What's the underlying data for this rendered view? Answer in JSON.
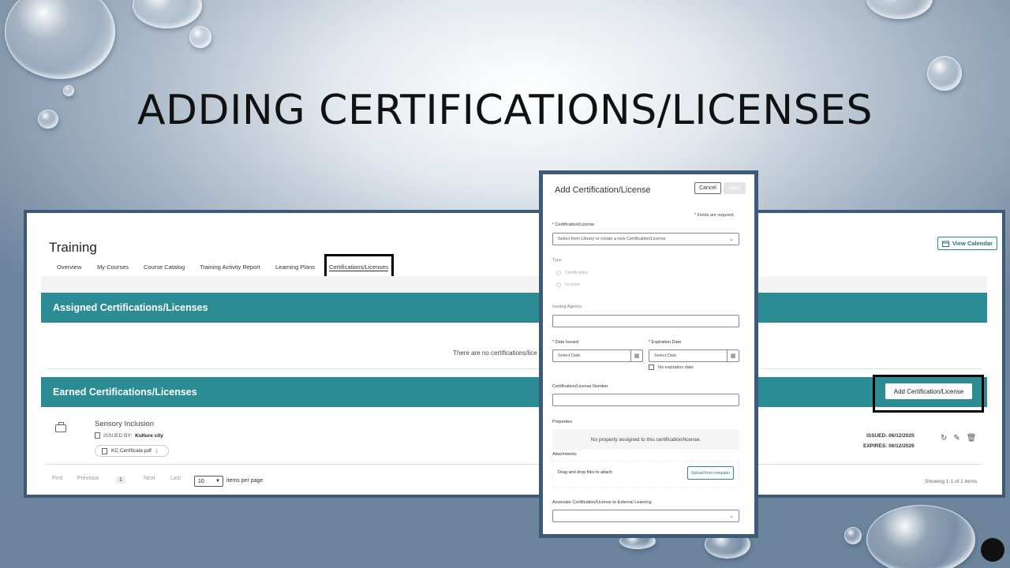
{
  "slide": {
    "title": "ADDING CERTIFICATIONS/LICENSES"
  },
  "training": {
    "title": "Training",
    "tabs": [
      "Overview",
      "My Courses",
      "Course Catalog",
      "Training Activity Report",
      "Learning Plans",
      "Certifications/Licenses"
    ],
    "active_tab": "Certifications/Licenses",
    "view_calendar": "View Calendar",
    "assigned_header": "Assigned Certifications/Licenses",
    "assigned_empty": "There are no certifications/lice",
    "earned_header": "Earned Certifications/Licenses",
    "add_button": "Add Certification/License",
    "earned_item": {
      "name": "Sensory Inclusion",
      "issued_by_label": "ISSUED BY:",
      "issued_by": "Kulture city",
      "file": "KC Certificate.pdf",
      "issued": "ISSUED: 06/12/2025",
      "expires": "EXPIRES: 06/12/2026"
    },
    "pagination": {
      "first": "First",
      "previous": "Previous",
      "current": "1",
      "next": "Next",
      "last": "Last",
      "per_page": "10",
      "per_page_label": "items per page",
      "showing": "Showing 1-1 of 1 items"
    }
  },
  "modal": {
    "title": "Add Certification/License",
    "cancel": "Cancel",
    "save": "Save",
    "required_note": "* Fields are required.",
    "cert_label": "* Certification/License",
    "cert_placeholder": "Select from Library or create a new Certification/License",
    "type_label": "Type",
    "type_options": [
      "Certification",
      "License"
    ],
    "agency_label": "Issuing Agency",
    "date_issued_label": "* Date Issued",
    "expiration_label": "* Expiration Date",
    "date_placeholder": "Select Date",
    "no_expiration": "No expiration date",
    "number_label": "Certification/License Number",
    "properties_label": "Properties",
    "properties_empty": "No property assigned to this certification/license.",
    "attachments_label": "Attachments",
    "drag_drop": "Drag and drop files to attach",
    "upload": "Upload from computer",
    "associate_label": "Associate Certification/License to External Learning"
  },
  "icons": [
    "calendar-icon",
    "briefcase-icon",
    "document-icon",
    "download-icon",
    "reset-icon",
    "edit-icon",
    "trash-icon",
    "chevron-down-icon"
  ]
}
